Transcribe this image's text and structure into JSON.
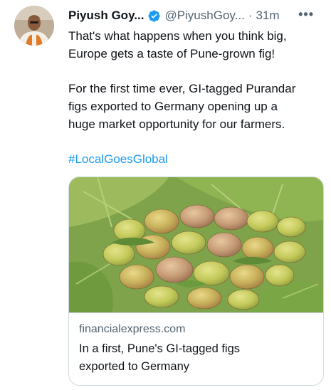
{
  "tweet": {
    "display_name": "Piyush Goy...",
    "handle": "@PiyushGoy...",
    "separator": "·",
    "time": "31m",
    "more_label": "•••",
    "text_line1": "That's what happens when you think big,",
    "text_line2": "Europe gets a taste of Pune-grown fig!",
    "text_line3": "For the first time ever, GI-tagged Purandar",
    "text_line4": "figs exported to Germany opening up a",
    "text_line5": "huge market opportunity for our farmers.",
    "hashtag": "#LocalGoesGlobal"
  },
  "card": {
    "domain": "financialexpress.com",
    "title_line1": "In a first, Pune's GI-tagged figs",
    "title_line2": "exported to Germany",
    "image_icon": "figs-photo"
  },
  "icons": {
    "verified": "verified-badge-icon",
    "more": "more-dots-icon",
    "avatar": "user-avatar"
  },
  "colors": {
    "text": "#0f1419",
    "secondary": "#536471",
    "link": "#1d9bf0",
    "border": "#cfd9de",
    "verified": "#1d9bf0"
  }
}
